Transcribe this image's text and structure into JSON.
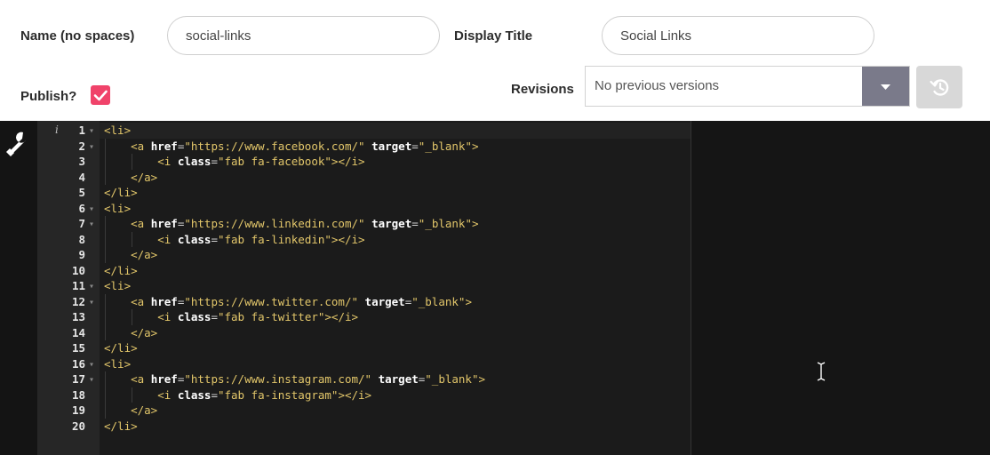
{
  "form": {
    "name_label": "Name (no spaces)",
    "name_value": "social-links",
    "title_label": "Display Title",
    "title_value": "Social Links",
    "publish_label": "Publish?",
    "publish_checked": true,
    "revisions_label": "Revisions",
    "revisions_value": "No previous versions",
    "accent_color": "#f0436a"
  },
  "editor": {
    "info_glyph": "i",
    "lines": [
      {
        "n": "1",
        "fold": true,
        "indent": 0,
        "kind": "open_li"
      },
      {
        "n": "2",
        "fold": true,
        "indent": 1,
        "kind": "a",
        "url": "\"https://www.facebook.com/\""
      },
      {
        "n": "3",
        "fold": false,
        "indent": 2,
        "kind": "i",
        "cls": "\"fab fa-facebook\""
      },
      {
        "n": "4",
        "fold": false,
        "indent": 1,
        "kind": "close_a"
      },
      {
        "n": "5",
        "fold": false,
        "indent": 0,
        "kind": "close_li"
      },
      {
        "n": "6",
        "fold": true,
        "indent": 0,
        "kind": "open_li"
      },
      {
        "n": "7",
        "fold": true,
        "indent": 1,
        "kind": "a",
        "url": "\"https://www.linkedin.com/\""
      },
      {
        "n": "8",
        "fold": false,
        "indent": 2,
        "kind": "i",
        "cls": "\"fab fa-linkedin\""
      },
      {
        "n": "9",
        "fold": false,
        "indent": 1,
        "kind": "close_a"
      },
      {
        "n": "10",
        "fold": false,
        "indent": 0,
        "kind": "close_li"
      },
      {
        "n": "11",
        "fold": true,
        "indent": 0,
        "kind": "open_li"
      },
      {
        "n": "12",
        "fold": true,
        "indent": 1,
        "kind": "a",
        "url": "\"https://www.twitter.com/\""
      },
      {
        "n": "13",
        "fold": false,
        "indent": 2,
        "kind": "i",
        "cls": "\"fab fa-twitter\""
      },
      {
        "n": "14",
        "fold": false,
        "indent": 1,
        "kind": "close_a"
      },
      {
        "n": "15",
        "fold": false,
        "indent": 0,
        "kind": "close_li"
      },
      {
        "n": "16",
        "fold": true,
        "indent": 0,
        "kind": "open_li"
      },
      {
        "n": "17",
        "fold": true,
        "indent": 1,
        "kind": "a",
        "url": "\"https://www.instagram.com/\""
      },
      {
        "n": "18",
        "fold": false,
        "indent": 2,
        "kind": "i",
        "cls": "\"fab fa-instagram\""
      },
      {
        "n": "19",
        "fold": false,
        "indent": 1,
        "kind": "close_a"
      },
      {
        "n": "20",
        "fold": false,
        "indent": 0,
        "kind": "close_li"
      }
    ],
    "tokens": {
      "open_li": "<li>",
      "close_li": "</li>",
      "a_open": "<a",
      "href_attr": "href",
      "target_attr": "target",
      "target_val": "\"_blank\"",
      "tag_end": ">",
      "close_a": "</a>",
      "i_open": "<i",
      "class_attr": "class",
      "close_i": "></i>",
      "eq": "="
    }
  }
}
